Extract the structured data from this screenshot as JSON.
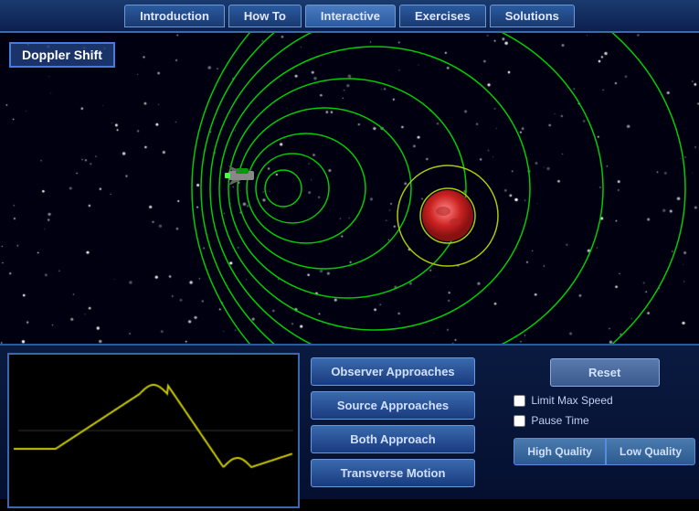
{
  "nav": {
    "tabs": [
      {
        "label": "Introduction",
        "active": false
      },
      {
        "label": "How To",
        "active": false
      },
      {
        "label": "Interactive",
        "active": true
      },
      {
        "label": "Exercises",
        "active": false
      },
      {
        "label": "Solutions",
        "active": false
      }
    ]
  },
  "title": "Doppler Shift",
  "buttons": {
    "observer_approaches": "Observer Approaches",
    "source_approaches": "Source Approaches",
    "both_approach": "Both Approach",
    "transverse_motion": "Transverse Motion",
    "reset": "Reset",
    "high_quality": "High Quality",
    "low_quality": "Low Quality"
  },
  "checkboxes": {
    "limit_max_speed": "Limit Max Speed",
    "pause_time": "Pause Time"
  },
  "colors": {
    "accent": "#3a6aae",
    "ring_color": "#00cc00",
    "orbit_color": "#aacc00",
    "graph_line": "#cccc00"
  }
}
